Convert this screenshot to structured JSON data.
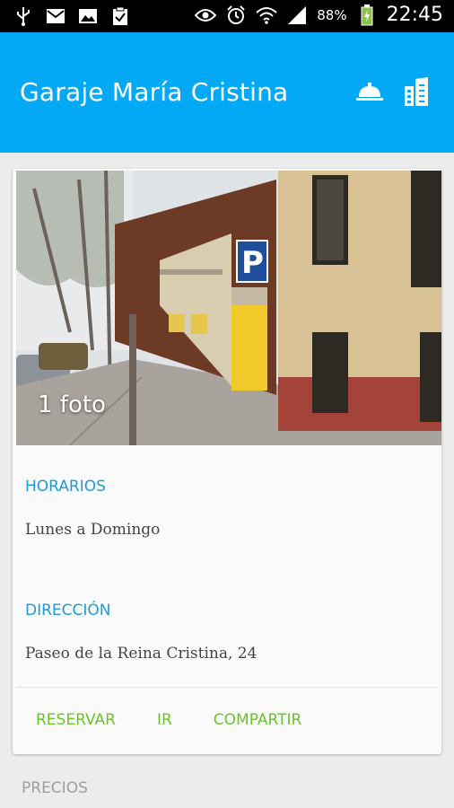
{
  "status_bar": {
    "icons_left": [
      "usb-icon",
      "mail-icon",
      "image-icon",
      "clipboard-icon"
    ],
    "icons_right": [
      "eye-icon",
      "alarm-icon",
      "wifi-icon",
      "signal-icon"
    ],
    "battery_percent": "88%",
    "time": "22:45"
  },
  "app_bar": {
    "title": "Garaje María Cristina",
    "color": "#03a9f4",
    "actions": [
      "service-bell-icon",
      "buildings-icon"
    ]
  },
  "card": {
    "photo_count": "1 foto",
    "hours_label": "HORARIOS",
    "hours_value": "Lunes a Domingo",
    "address_label": "DIRECCIÓN",
    "address_value": "Paseo de la Reina Cristina, 24",
    "actions": {
      "reserve": "RESERVAR",
      "go": "IR",
      "share": "COMPARTIR"
    },
    "accent_color": "#1e9bd7",
    "action_color": "#6ac52a"
  },
  "bottom_section": {
    "label": "PRECIOS"
  }
}
